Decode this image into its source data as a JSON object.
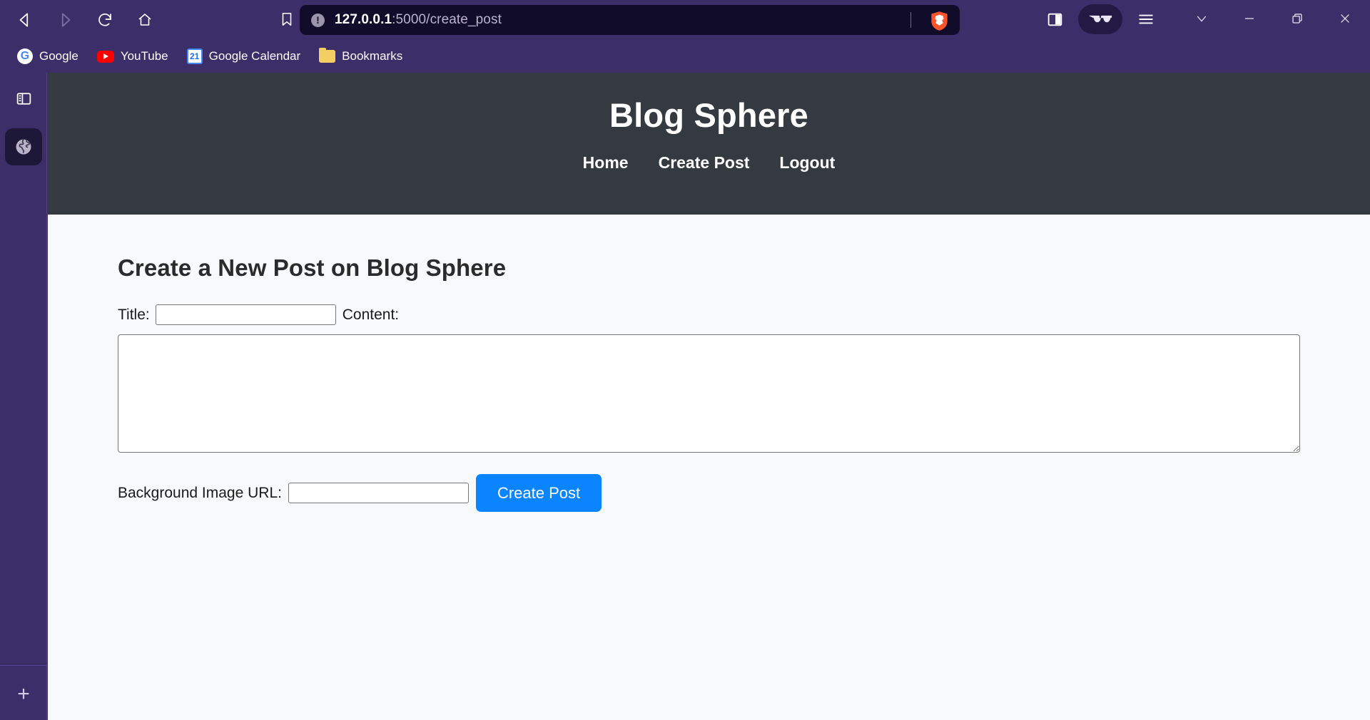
{
  "browser": {
    "nav": {
      "back_label": "Back",
      "forward_label": "Forward",
      "reload_label": "Reload",
      "home_label": "Home"
    },
    "bookmark_star_label": "Bookmark this page",
    "url": {
      "host": "127.0.0.1",
      "path": ":5000/create_post",
      "full": "127.0.0.1:5000/create_post",
      "site_info_glyph": "!",
      "shield_label": "Brave Shields"
    },
    "right_tools": {
      "split_view_label": "Split view",
      "reader_label": "Reader mode",
      "menu_label": "Customize and control Brave"
    },
    "window_controls": {
      "expand_label": "∨",
      "minimize_label": "—",
      "restore_label": "Restore",
      "close_label": "✕"
    },
    "bookmarks": [
      {
        "label": "Google",
        "icon": "google-icon",
        "glyph": "G"
      },
      {
        "label": "YouTube",
        "icon": "youtube-icon",
        "glyph": ""
      },
      {
        "label": "Google Calendar",
        "icon": "google-calendar-icon",
        "glyph": "21"
      },
      {
        "label": "Bookmarks",
        "icon": "folder-icon",
        "glyph": ""
      }
    ]
  },
  "sidebar": {
    "panel_toggle_label": "Toggle sidebar",
    "globe_label": "Brave Talk / Web",
    "add_label": "+"
  },
  "site": {
    "title": "Blog Sphere",
    "nav": [
      {
        "label": "Home"
      },
      {
        "label": "Create Post"
      },
      {
        "label": "Logout"
      }
    ],
    "header_bg": "#343a40"
  },
  "form": {
    "heading": "Create a New Post on Blog Sphere",
    "title_label": "Title:",
    "title_value": "",
    "title_placeholder": "",
    "content_label": "Content:",
    "content_value": "",
    "content_placeholder": "",
    "bg_url_label": "Background Image URL:",
    "bg_url_value": "",
    "bg_url_placeholder": "",
    "submit_label": "Create Post",
    "submit_color": "#0a84ff"
  }
}
